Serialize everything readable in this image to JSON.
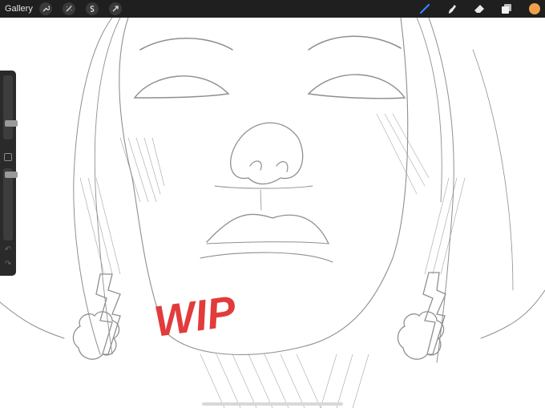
{
  "topbar": {
    "gallery_label": "Gallery",
    "left_tools": [
      {
        "name": "wrench-icon"
      },
      {
        "name": "magic-wand-icon"
      },
      {
        "name": "selection-icon"
      },
      {
        "name": "transform-arrow-icon"
      }
    ],
    "right_tools": [
      {
        "name": "brush-icon",
        "active_color": "#3d7fff"
      },
      {
        "name": "smudge-icon"
      },
      {
        "name": "eraser-icon"
      },
      {
        "name": "layers-icon"
      }
    ],
    "current_color": "#f0a04b"
  },
  "canvas": {
    "annotation_text": "WIP",
    "annotation_color": "#e23b3b",
    "sketch_color": "#8f8f8f"
  },
  "sidebar": {
    "size_slider": 0.22,
    "opacity_slider": 0.95,
    "undo_icon": "↶",
    "redo_icon": "↷"
  }
}
